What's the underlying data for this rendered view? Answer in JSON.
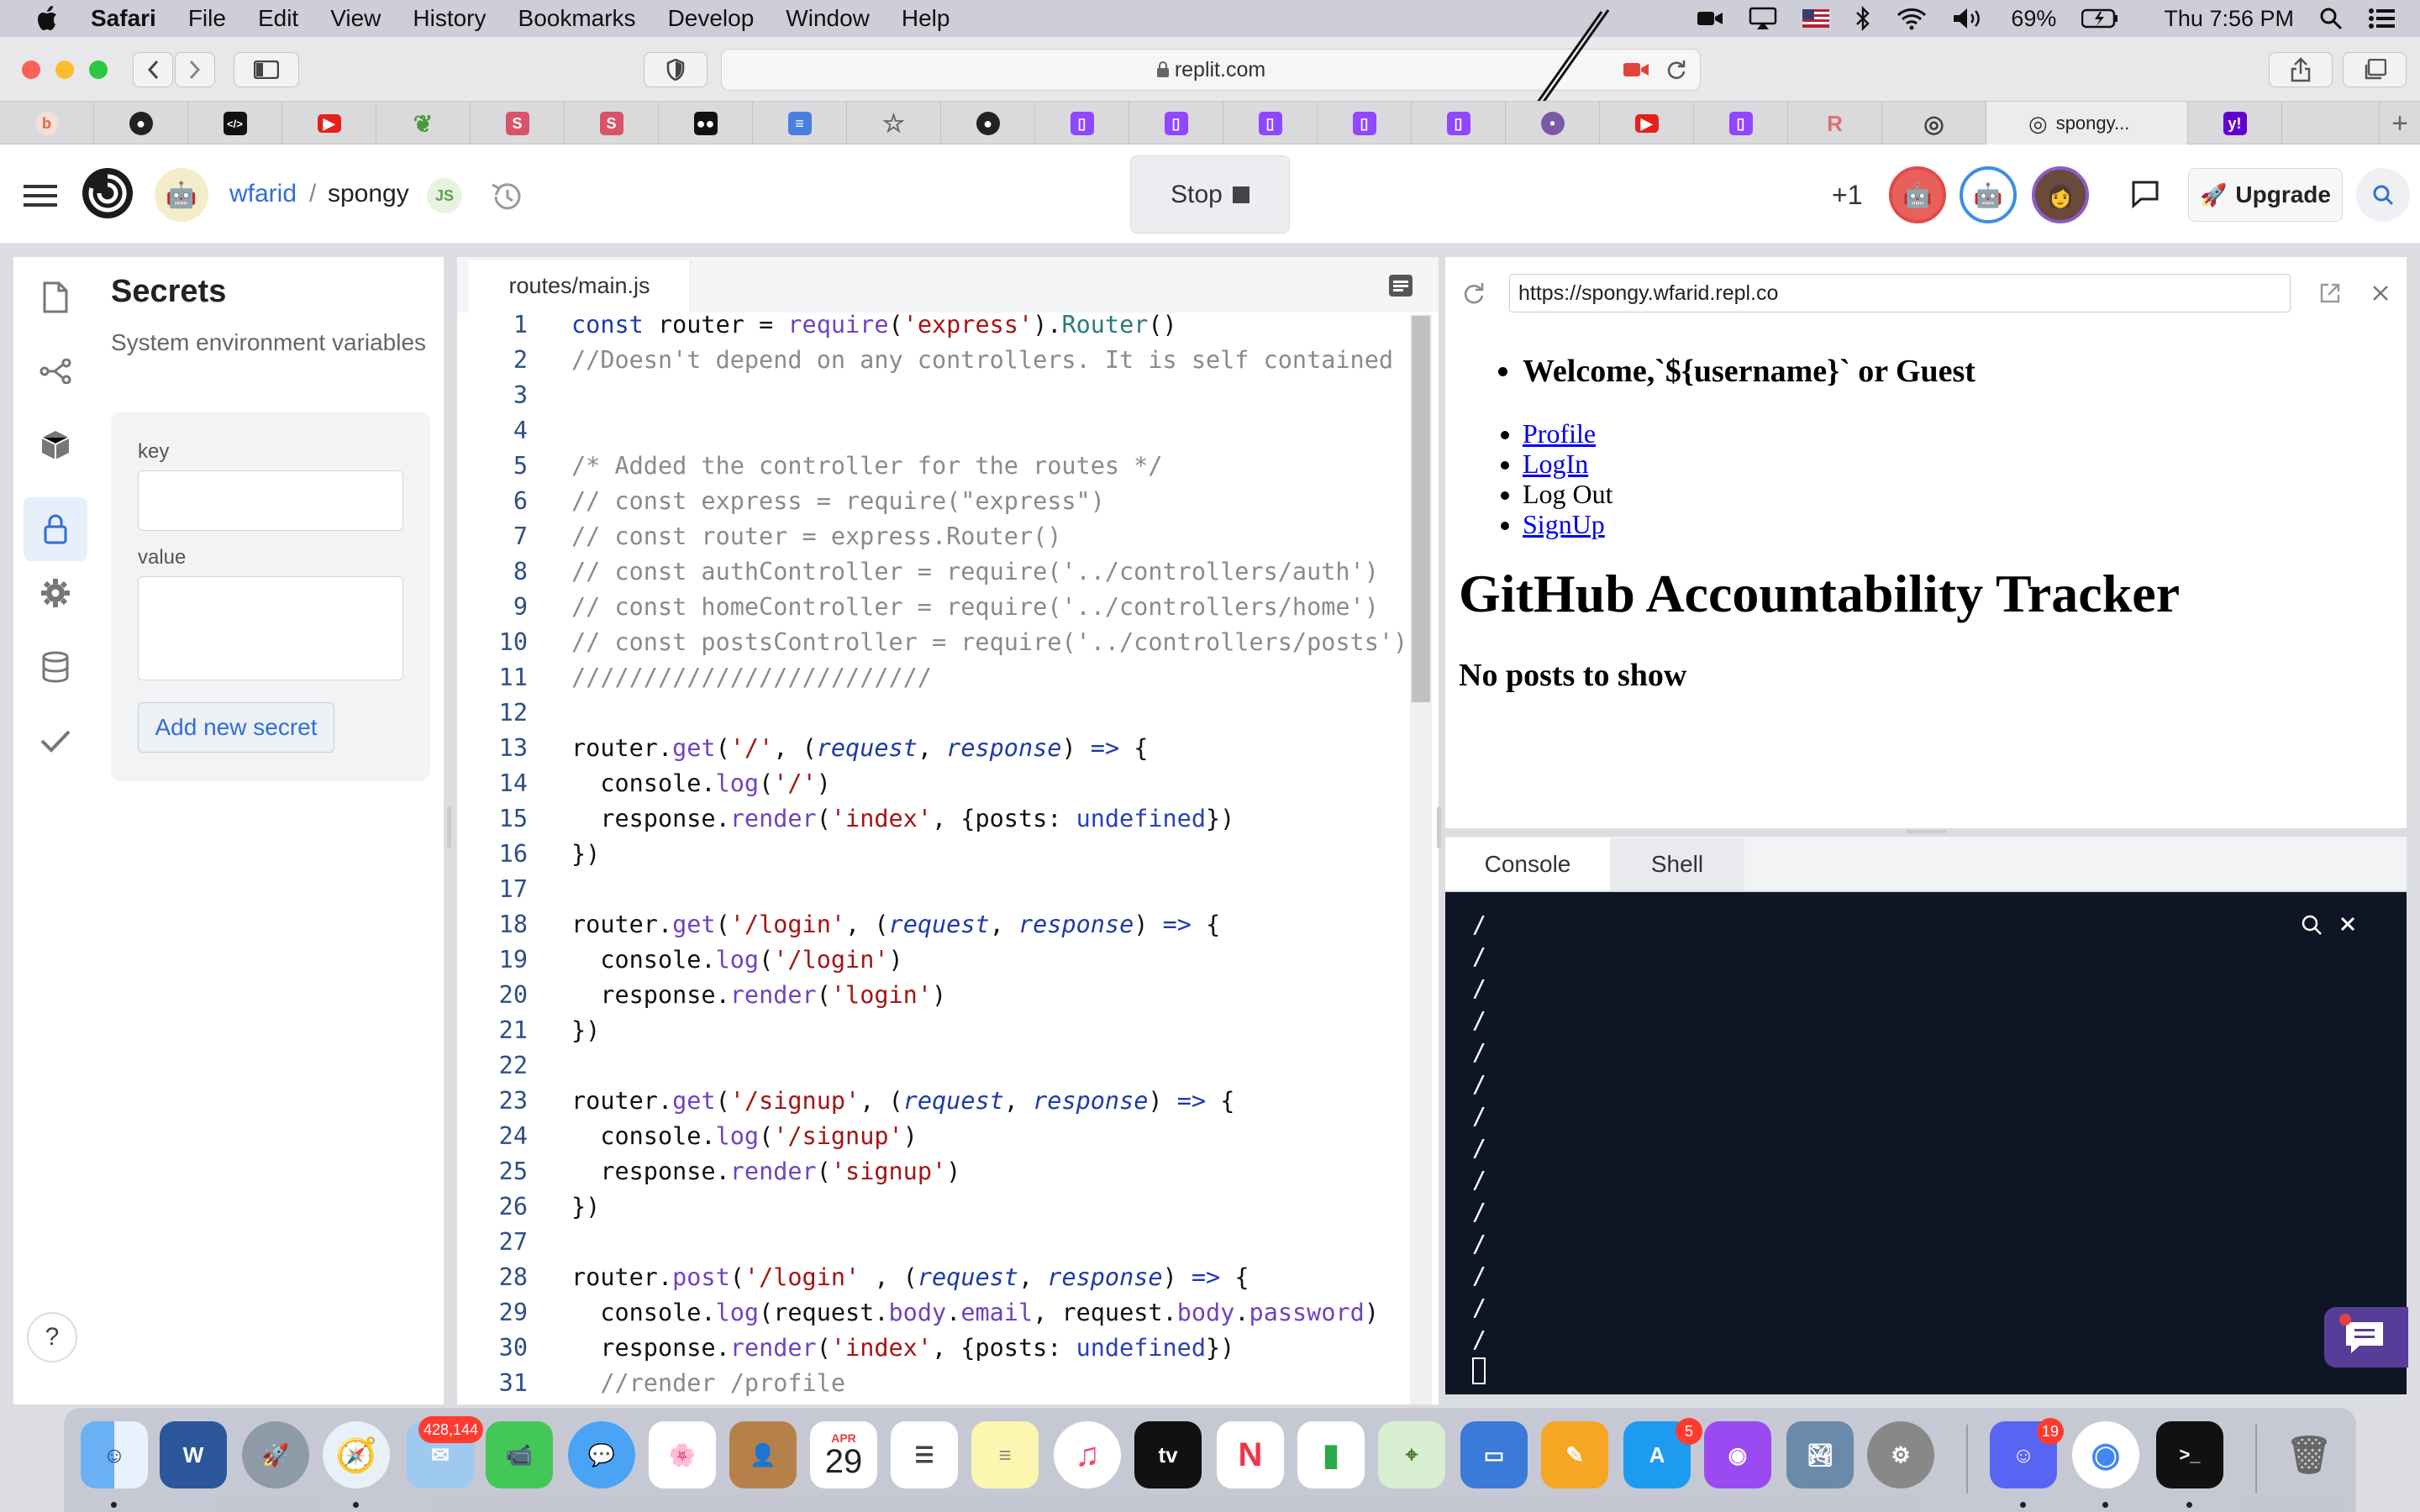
{
  "menubar": {
    "app": "Safari",
    "items": [
      "File",
      "Edit",
      "View",
      "History",
      "Bookmarks",
      "Develop",
      "Window",
      "Help"
    ],
    "battery": "69%",
    "clock": "Thu 7:56 PM"
  },
  "safari": {
    "url": "replit.com",
    "active_tab_title": "spongy..."
  },
  "replit": {
    "user": "wfarid",
    "separator": "/",
    "repl_name": "spongy",
    "stop_label": "Stop",
    "plus_count": "+1",
    "upgrade_label": "Upgrade"
  },
  "secrets": {
    "title": "Secrets",
    "subtitle": "System environment variables",
    "key_label": "key",
    "value_label": "value",
    "add_button": "Add new secret",
    "help": "?"
  },
  "editor": {
    "tab": "routes/main.js",
    "line_numbers": [
      "1",
      "2",
      "3",
      "4",
      "5",
      "6",
      "7",
      "8",
      "9",
      "10",
      "11",
      "12",
      "13",
      "14",
      "15",
      "16",
      "17",
      "18",
      "19",
      "20",
      "21",
      "22",
      "23",
      "24",
      "25",
      "26",
      "27",
      "28",
      "29",
      "30",
      "31"
    ]
  },
  "webview": {
    "url": "https://spongy.wfarid.repl.co",
    "welcome": "Welcome,`${username}` or Guest",
    "nav": [
      "Profile",
      "LogIn",
      "Log Out",
      "SignUp"
    ],
    "heading": "GitHub Accountability Tracker",
    "empty": "No posts to show"
  },
  "console": {
    "tabs": [
      "Console",
      "Shell"
    ],
    "lines": [
      "/",
      "/",
      "/",
      "/",
      "/",
      "/",
      "/",
      "/",
      "/",
      "/",
      "/",
      "/",
      "/",
      "/"
    ]
  },
  "dock": {
    "badges": {
      "mail": "428,144",
      "appstore": "5",
      "discord": "19"
    },
    "calendar_month": "APR",
    "calendar_day": "29"
  },
  "colors": {
    "replit_link": "#2f6fd6",
    "console_bg": "#0e1525",
    "chat_button": "#563d9a"
  }
}
